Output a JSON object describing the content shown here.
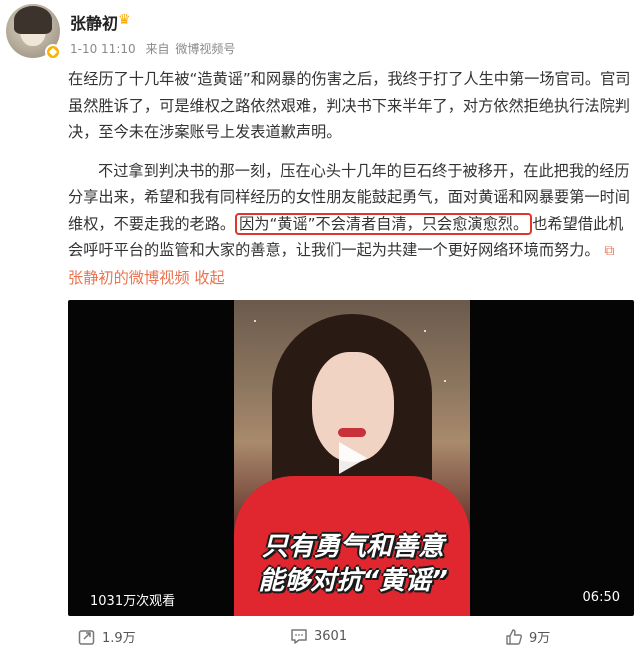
{
  "author": {
    "name": "张静初",
    "time": "1-10 11:10",
    "source_prefix": "来自",
    "source": "微博视频号"
  },
  "post": {
    "p1": "在经历了十几年被“造黄谣”和网暴的伤害之后，我终于打了人生中第一场官司。官司虽然胜诉了，可是维权之路依然艰难，判决书下来半年了，对方依然拒绝执行法院判决，至今未在涉案账号上发表道歉声明。",
    "p2_before": "不过拿到判决书的那一刻，压在心头十几年的巨石终于被移开，在此把我的经历分享出来，希望和我有同样经历的女性朋友能鼓起勇气，面对黄谣和网暴要第一时间维权，不要走我的老路。",
    "p2_highlight": "因为“黄谣”不会清者自清，只会愈演愈烈。",
    "p2_after": "也希望借此机会呼吁平台的监管和大家的善意，让我们一起为共建一个更好网络环境而努力。",
    "video_link": "张静初的微博视频",
    "collapse": "收起"
  },
  "video": {
    "caption_line1": "只有勇气和善意",
    "caption_line2": "能够对抗“黄谣”",
    "views": "1031万次观看",
    "duration": "06:50"
  },
  "actions": {
    "share_count": "1.9万",
    "comment_count": "3601",
    "like_count": "9万"
  },
  "colors": {
    "link": "#eb7350",
    "highlight_border": "#e0352b",
    "verified": "#f7b500"
  }
}
